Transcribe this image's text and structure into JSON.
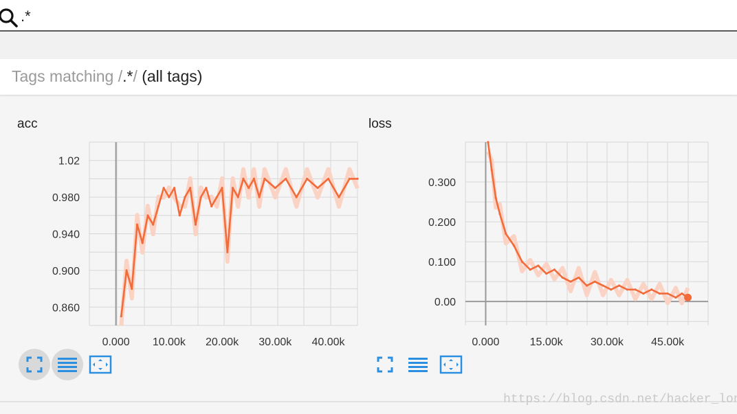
{
  "search": {
    "query": ".*",
    "icon": "search-icon"
  },
  "tags": {
    "prefix": "Tags matching /",
    "pattern": ".*",
    "suffix": "/",
    "note": "(all tags)"
  },
  "colors": {
    "accent": "#f26b3a",
    "raw_series": "#fbd3c4",
    "control_blue": "#2a8fe0",
    "grid": "#d6d6d6"
  },
  "charts": [
    {
      "title": "acc",
      "ytick_labels": [
        "1.02",
        "0.980",
        "0.940",
        "0.900",
        "0.860"
      ],
      "xtick_labels": [
        "0.000",
        "10.00k",
        "20.00k",
        "30.00k",
        "40.00k"
      ],
      "controls": [
        "fit-domain",
        "toggle-log",
        "fit-to-data"
      ]
    },
    {
      "title": "loss",
      "ytick_labels": [
        "0.300",
        "0.200",
        "0.100",
        "0.00"
      ],
      "xtick_labels": [
        "0.000",
        "15.00k",
        "30.00k",
        "45.00k"
      ],
      "controls": [
        "fit-domain",
        "toggle-log",
        "fit-to-data"
      ]
    }
  ],
  "chart_data": [
    {
      "type": "line",
      "title": "acc",
      "xlim": [
        -5000,
        45500
      ],
      "ylim": [
        0.84,
        1.04
      ],
      "series": [
        {
          "x": [
            1000,
            2000,
            3000,
            4000,
            5000,
            6000,
            7000,
            8000,
            9000,
            10000,
            11000,
            12000,
            13000,
            14000,
            15000,
            16000,
            17000,
            18000,
            19000,
            20000,
            21000,
            22000,
            23000,
            24000,
            25000,
            26000,
            27000,
            28000,
            30000,
            32000,
            34000,
            36000,
            38000,
            40000,
            42000,
            44000,
            45500
          ],
          "y": [
            0.85,
            0.9,
            0.88,
            0.95,
            0.93,
            0.96,
            0.95,
            0.97,
            0.99,
            0.98,
            0.99,
            0.96,
            0.98,
            0.99,
            0.95,
            0.98,
            0.99,
            0.97,
            0.98,
            0.99,
            0.92,
            0.99,
            0.98,
            1.0,
            0.99,
            1.0,
            0.98,
            1.0,
            0.99,
            1.0,
            0.98,
            1.0,
            0.99,
            1.0,
            0.98,
            1.0,
            1.0
          ]
        }
      ]
    },
    {
      "type": "line",
      "title": "loss",
      "xlim": [
        -5000,
        55000
      ],
      "ylim": [
        -0.06,
        0.4
      ],
      "series": [
        {
          "x": [
            600,
            1500,
            2500,
            3500,
            5000,
            7000,
            9000,
            11000,
            13000,
            15000,
            17000,
            19000,
            21000,
            23000,
            25000,
            27000,
            29000,
            31000,
            33000,
            35000,
            37000,
            39000,
            41000,
            43000,
            45000,
            47000,
            48500,
            50000
          ],
          "y": [
            0.4,
            0.33,
            0.26,
            0.22,
            0.17,
            0.14,
            0.1,
            0.08,
            0.09,
            0.07,
            0.08,
            0.06,
            0.05,
            0.06,
            0.04,
            0.05,
            0.04,
            0.03,
            0.04,
            0.03,
            0.03,
            0.02,
            0.03,
            0.02,
            0.02,
            0.01,
            0.02,
            0.01
          ]
        }
      ]
    }
  ],
  "watermark": "https://blog.csdn.net/hacker_long"
}
